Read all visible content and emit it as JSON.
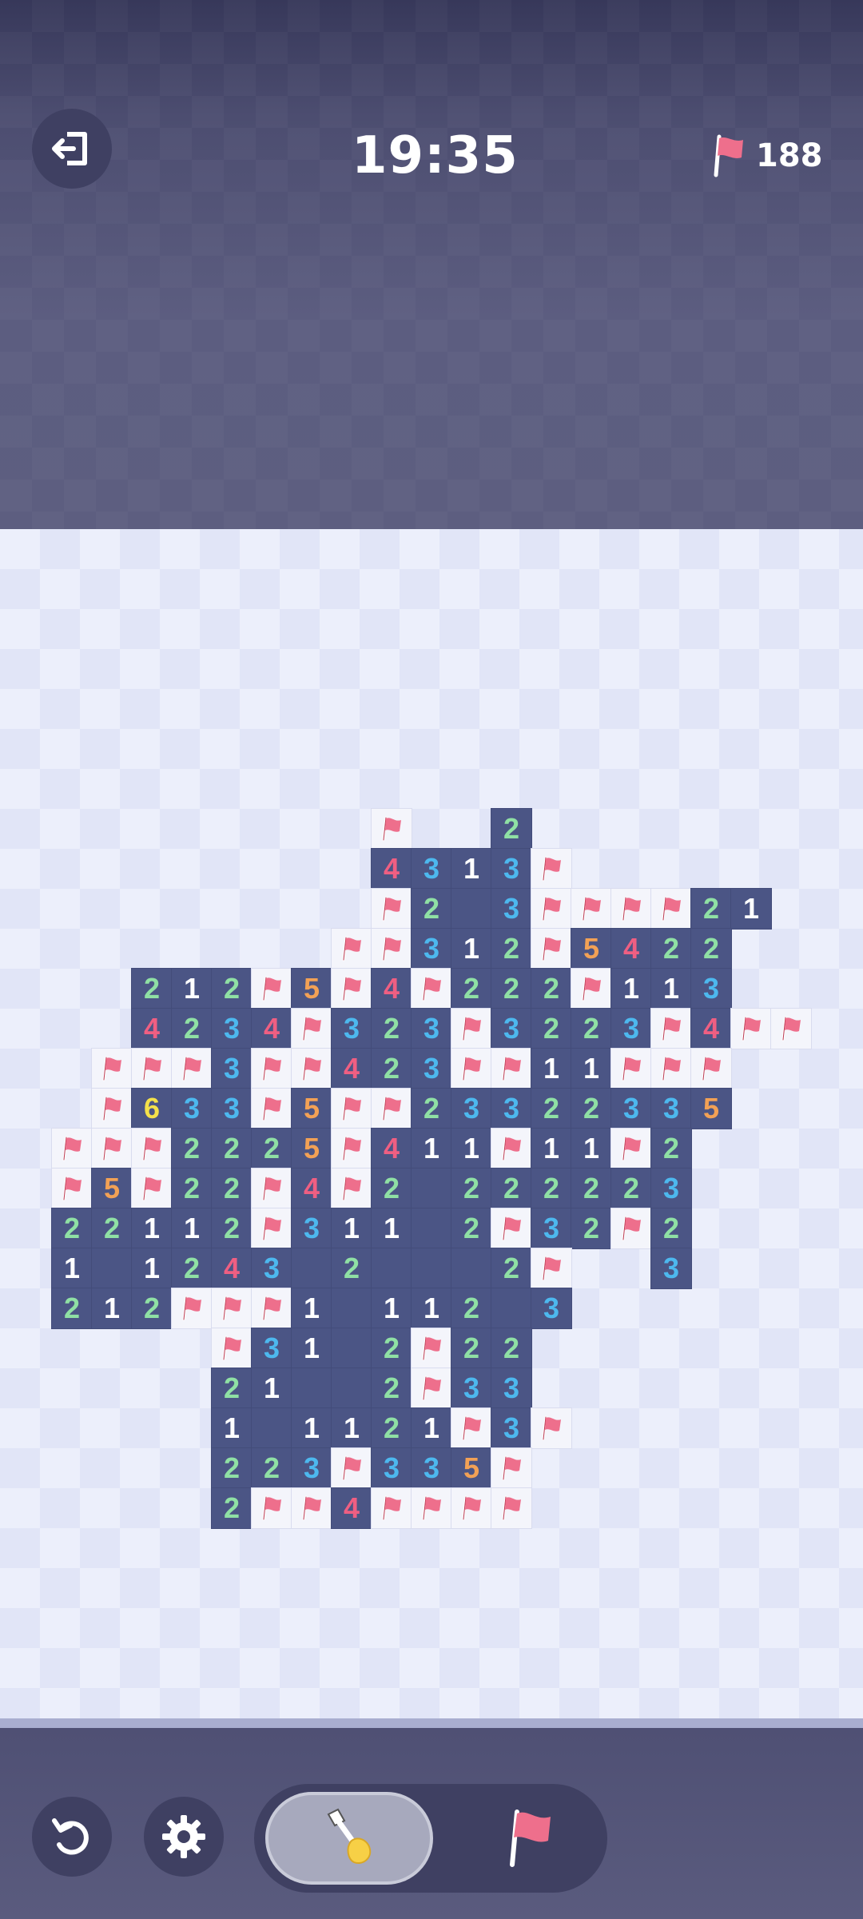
{
  "header": {
    "timer": "19:35",
    "flags_remaining": "188",
    "exit_icon": "exit-icon",
    "flag_icon": "flag-icon"
  },
  "colors": {
    "1": "#ffffff",
    "2": "#8fe0a4",
    "3": "#4db8ee",
    "4": "#ef5f82",
    "5": "#f2a155",
    "6": "#f4e14a",
    "flag": "#ee6f8c"
  },
  "board": {
    "rows": [
      "......................",
      "......................",
      "......................",
      "......................",
      "......................",
      "......................",
      "......................",
      ".........F..2.........",
      ".........4313F........",
      ".........F2_3FFFF21...",
      "........FF312F5422....",
      "...212F5F4F222F113....",
      "...4234F323F3223F4FF..",
      "..FFF3FF423FF11FFF....",
      "..F633F5FF23322335....",
      ".FFF2225F411F11F2.....",
      ".F5F22F4F2_222223.....",
      ".22112F311_2F32F2.....",
      ".1_1243_2___2F..3.....",
      ".212FFF1_112_3........",
      ".....F31_2F22.........",
      ".....21__2F33.........",
      ".....1_1121F3F........",
      ".....223F335F.........",
      ".....2FF4FFFF.........",
      "......................",
      "......................",
      "......................",
      "......................",
      "......................"
    ]
  },
  "controls": {
    "undo_icon": "undo-icon",
    "settings_icon": "gear-icon",
    "dig_mode_icon": "shovel-icon",
    "flag_mode_icon": "flag-icon",
    "active_mode": "dig"
  }
}
